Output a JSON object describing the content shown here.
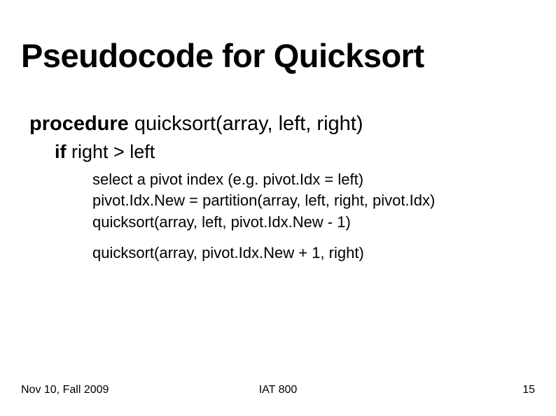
{
  "title": "Pseudocode for Quicksort",
  "proc": {
    "kw": "procedure",
    "sig": " quicksort(array, left, right)"
  },
  "cond": {
    "kw": "if",
    "expr": " right > left"
  },
  "code": {
    "l1": "select a pivot index (e.g. pivot.Idx = left)",
    "l2": "pivot.Idx.New = partition(array, left, right, pivot.Idx)",
    "l3": "quicksort(array, left, pivot.Idx.New - 1)",
    "l4": "quicksort(array, pivot.Idx.New + 1, right)"
  },
  "footer": {
    "left": "Nov 10, Fall 2009",
    "center": "IAT 800",
    "right": "15"
  }
}
